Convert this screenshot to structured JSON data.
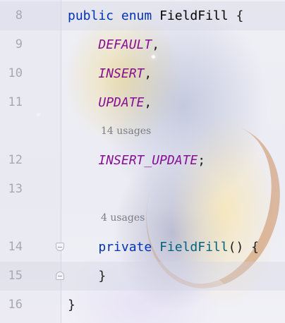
{
  "editor": {
    "lines": [
      {
        "number": "8",
        "tokens": [
          [
            "kw",
            "public"
          ],
          [
            "plain",
            " "
          ],
          [
            "kw",
            "enum"
          ],
          [
            "plain",
            " "
          ],
          [
            "type",
            "FieldFill"
          ],
          [
            "plain",
            " {"
          ]
        ]
      },
      {
        "number": "9",
        "tokens": [
          [
            "plain",
            "    "
          ],
          [
            "const",
            "DEFAULT"
          ],
          [
            "plain",
            ","
          ]
        ]
      },
      {
        "number": "10",
        "tokens": [
          [
            "plain",
            "    "
          ],
          [
            "const",
            "INSERT"
          ],
          [
            "plain",
            ","
          ]
        ]
      },
      {
        "number": "11",
        "tokens": [
          [
            "plain",
            "    "
          ],
          [
            "const",
            "UPDATE"
          ],
          [
            "plain",
            ","
          ]
        ]
      },
      {
        "number": "12",
        "tokens": [
          [
            "plain",
            "    "
          ],
          [
            "const",
            "INSERT_UPDATE"
          ],
          [
            "plain",
            ";"
          ]
        ]
      },
      {
        "number": "13",
        "tokens": []
      },
      {
        "number": "14",
        "tokens": [
          [
            "plain",
            "    "
          ],
          [
            "kw",
            "private"
          ],
          [
            "plain",
            " "
          ],
          [
            "meth",
            "FieldFill"
          ],
          [
            "plain",
            "() {"
          ]
        ]
      },
      {
        "number": "15",
        "tokens": [
          [
            "plain",
            "    }"
          ]
        ]
      },
      {
        "number": "16",
        "tokens": [
          [
            "plain",
            "}"
          ]
        ]
      }
    ],
    "usage_hints": [
      {
        "text": "14 usages"
      },
      {
        "text": "4 usages"
      }
    ]
  },
  "colors": {
    "keyword": "#0033b3",
    "constant": "#871094",
    "method": "#00627a",
    "line_number": "#a8a8b4",
    "usage_hint": "#7c7c86"
  }
}
